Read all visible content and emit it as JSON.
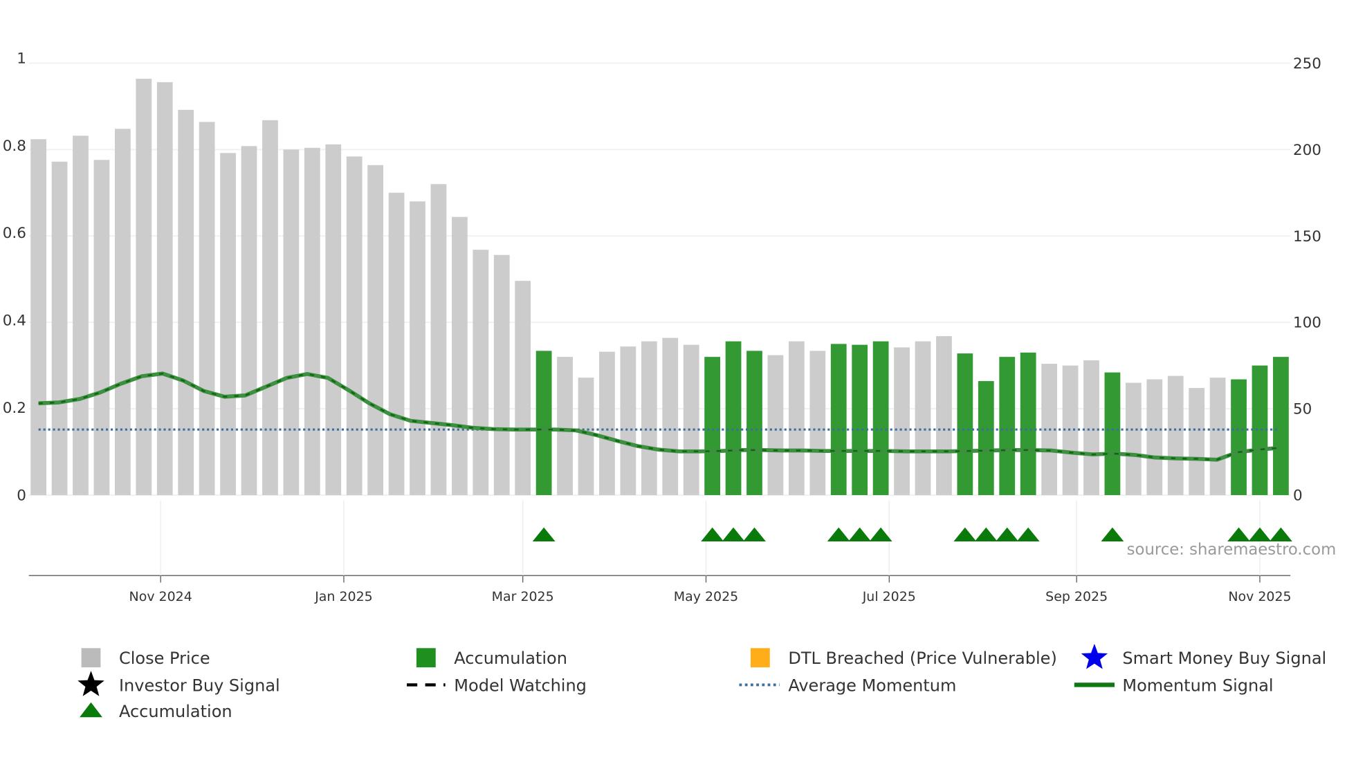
{
  "chart_data": {
    "type": "bar",
    "title": "",
    "left_axis": {
      "ticks": [
        "0",
        "0.2",
        "0.4",
        "0.6",
        "0.8",
        "1"
      ],
      "range": [
        0,
        1
      ]
    },
    "right_axis": {
      "ticks": [
        "0",
        "50",
        "100",
        "150",
        "200",
        "250"
      ],
      "range": [
        0,
        250
      ]
    },
    "x_ticks": [
      {
        "label": "Nov 2024",
        "bar_index": 5.8
      },
      {
        "label": "Jan 2025",
        "bar_index": 14.5
      },
      {
        "label": "Mar 2025",
        "bar_index": 23.0
      },
      {
        "label": "May 2025",
        "bar_index": 31.7
      },
      {
        "label": "Jul 2025",
        "bar_index": 40.4
      },
      {
        "label": "Sep 2025",
        "bar_index": 49.3
      },
      {
        "label": "Nov 2025",
        "bar_index": 58.0
      }
    ],
    "close_price": [
      206,
      193,
      208,
      194,
      212,
      241,
      239,
      223,
      216,
      198,
      202,
      217,
      200,
      201,
      203,
      196,
      191,
      175,
      170,
      180,
      161,
      142,
      139,
      124,
      83.5,
      80,
      68,
      83,
      86,
      89,
      91,
      87,
      80,
      89,
      83.5,
      81,
      89,
      83.5,
      87.5,
      87,
      89,
      85.5,
      89,
      92,
      82,
      66,
      80,
      82.5,
      76,
      75,
      78,
      71,
      65,
      67,
      69,
      62,
      68,
      67,
      75,
      80
    ],
    "accumulation_bars": [
      24,
      32,
      33,
      34,
      38,
      39,
      40,
      44,
      45,
      46,
      47,
      51,
      57,
      58,
      59
    ],
    "momentum_signal": [
      0.21,
      0.212,
      0.22,
      0.235,
      0.255,
      0.272,
      0.278,
      0.262,
      0.238,
      0.225,
      0.228,
      0.248,
      0.268,
      0.277,
      0.268,
      0.24,
      0.21,
      0.185,
      0.17,
      0.165,
      0.16,
      0.154,
      0.151,
      0.15,
      0.15,
      0.15,
      0.148,
      0.137,
      0.124,
      0.112,
      0.104,
      0.1,
      0.1,
      0.101,
      0.103,
      0.103,
      0.102,
      0.102,
      0.101,
      0.101,
      0.101,
      0.101,
      0.1,
      0.1,
      0.1,
      0.101,
      0.102,
      0.103,
      0.103,
      0.102,
      0.097,
      0.093,
      0.095,
      0.092,
      0.086,
      0.084,
      0.083,
      0.081,
      0.098,
      0.104,
      0.108
    ],
    "average_momentum": 0.15,
    "source": "source: sharemaestro.com",
    "legend": [
      {
        "label": "Close Price",
        "color": "#bbbbbb",
        "symbol": "square"
      },
      {
        "label": "Accumulation",
        "color": "#1f8f1f",
        "symbol": "square"
      },
      {
        "label": "DTL Breached (Price Vulnerable)",
        "color": "#ffae1a",
        "symbol": "square"
      },
      {
        "label": "Smart Money Buy Signal",
        "color": "#0000ee",
        "symbol": "star"
      },
      {
        "label": "Investor Buy Signal",
        "color": "#000000",
        "symbol": "star"
      },
      {
        "label": "Model Watching",
        "color": "#000000",
        "symbol": "dash"
      },
      {
        "label": "Average Momentum",
        "color": "#3a6fa0",
        "symbol": "dot"
      },
      {
        "label": "Momentum Signal",
        "color": "#117711",
        "symbol": "line"
      },
      {
        "label": "Accumulation",
        "color": "#0a7a0a",
        "symbol": "triangle"
      }
    ]
  }
}
